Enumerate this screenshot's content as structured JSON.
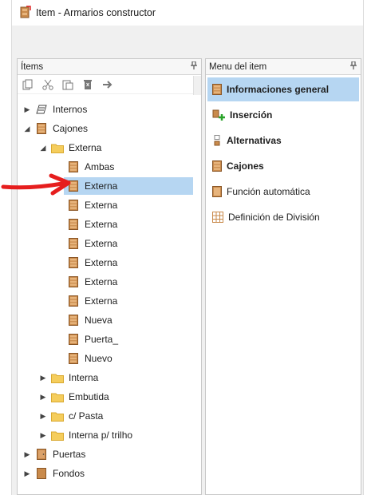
{
  "window": {
    "title": "Item - Armarios constructor"
  },
  "left_panel": {
    "header": "Ítems",
    "pin": "𝟜",
    "toolbar": [
      "copy-icon",
      "cut-icon",
      "paste-icon",
      "delete-icon",
      "arrow-right-icon"
    ],
    "tree": [
      {
        "label": "Internos",
        "arrow": "▶",
        "icon": "list",
        "indent": 0
      },
      {
        "label": "Cajones",
        "arrow": "◢",
        "icon": "drawer",
        "indent": 0
      },
      {
        "label": "Externa",
        "arrow": "◢",
        "icon": "folder",
        "indent": 1
      },
      {
        "label": "Ambas",
        "arrow": "",
        "icon": "drawer",
        "indent": 2
      },
      {
        "label": "Externa",
        "arrow": "",
        "icon": "drawer",
        "indent": 2,
        "selected": true
      },
      {
        "label": "Externa",
        "arrow": "",
        "icon": "drawer",
        "indent": 2
      },
      {
        "label": "Externa",
        "arrow": "",
        "icon": "drawer",
        "indent": 2
      },
      {
        "label": "Externa",
        "arrow": "",
        "icon": "drawer",
        "indent": 2
      },
      {
        "label": "Externa",
        "arrow": "",
        "icon": "drawer",
        "indent": 2
      },
      {
        "label": "Externa",
        "arrow": "",
        "icon": "drawer",
        "indent": 2
      },
      {
        "label": "Externa",
        "arrow": "",
        "icon": "drawer",
        "indent": 2
      },
      {
        "label": "Nueva",
        "arrow": "",
        "icon": "drawer",
        "indent": 2
      },
      {
        "label": "Puerta_",
        "arrow": "",
        "icon": "drawer",
        "indent": 2
      },
      {
        "label": "Nuevo",
        "arrow": "",
        "icon": "drawer",
        "indent": 2
      },
      {
        "label": "Interna",
        "arrow": "▶",
        "icon": "folder",
        "indent": 1
      },
      {
        "label": "Embutida",
        "arrow": "▶",
        "icon": "folder",
        "indent": 1
      },
      {
        "label": "c/ Pasta",
        "arrow": "▶",
        "icon": "folder",
        "indent": 1
      },
      {
        "label": "Interna p/ trilho",
        "arrow": "▶",
        "icon": "folder",
        "indent": 1
      },
      {
        "label": "Puertas",
        "arrow": "▶",
        "icon": "door",
        "indent": 0
      },
      {
        "label": "Fondos",
        "arrow": "▶",
        "icon": "panel",
        "indent": 0
      }
    ]
  },
  "right_panel": {
    "header": "Menu del item",
    "pin": "𝟜",
    "items": [
      {
        "label": "Informaciones general",
        "icon": "drawer",
        "bold": true,
        "active": true
      },
      {
        "label": "Inserción",
        "icon": "insert",
        "bold": true
      },
      {
        "label": "Alternativas",
        "icon": "alternatives",
        "bold": true
      },
      {
        "label": "Cajones",
        "icon": "drawer",
        "bold": true
      },
      {
        "label": "Función automática",
        "icon": "auto",
        "bold": false
      },
      {
        "label": "Definición de División",
        "icon": "grid",
        "bold": false
      }
    ]
  },
  "colors": {
    "selection": "#b6d6f2",
    "drawer_wood": "#c98a4b",
    "folder": "#f5cd5c",
    "annotation_arrow": "#e61e1e"
  }
}
